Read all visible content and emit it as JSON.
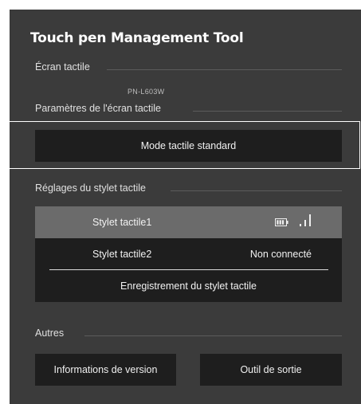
{
  "app": {
    "title": "Touch pen Management Tool"
  },
  "screen": {
    "section_label": "Écran tactile",
    "device_name": "PN-L603W"
  },
  "screen_settings": {
    "section_label": "Paramètres de l'écran tactile",
    "mode_button": "Mode tactile standard"
  },
  "pen_settings": {
    "section_label": "Réglages du stylet tactile",
    "pens": [
      {
        "name": "Stylet tactile1",
        "status": "",
        "battery_icon": "battery-icon",
        "signal_icon": "signal-strength-icon",
        "selected": true
      },
      {
        "name": "Stylet tactile2",
        "status": "Non connecté",
        "selected": false
      }
    ],
    "register_button": "Enregistrement du stylet tactile"
  },
  "others": {
    "section_label": "Autres",
    "version_button": "Informations de version",
    "exit_button": "Outil de sortie"
  },
  "colors": {
    "window_bg": "#3b3b3b",
    "button_bg": "#1e1e1e",
    "selected_row_bg": "#6b6b6b",
    "text": "#f0f0f0"
  }
}
